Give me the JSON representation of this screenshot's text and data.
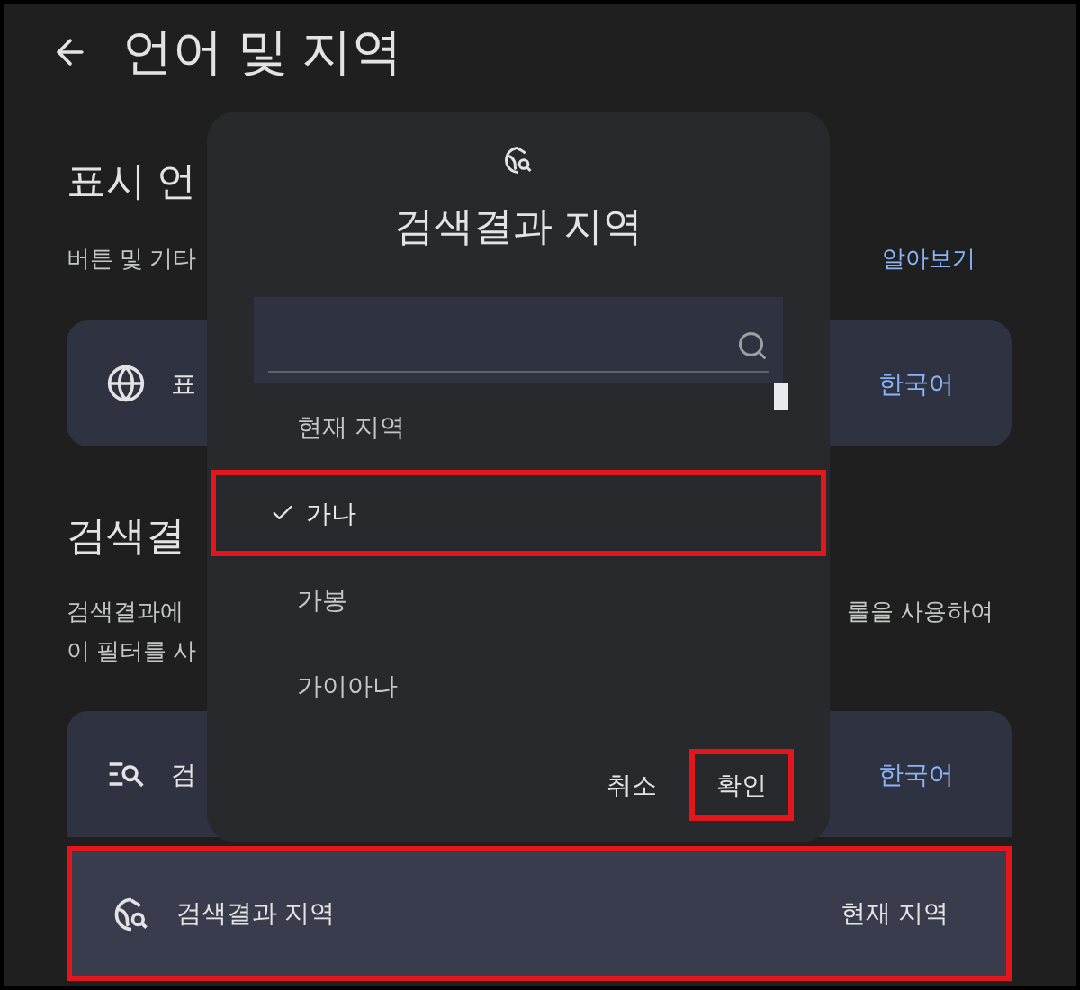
{
  "header": {
    "title": "언어 및 지역"
  },
  "display_section": {
    "heading": "표시 언",
    "description": "버튼 및 기타",
    "learn_more_link": "알아보기",
    "row": {
      "kind": "language",
      "label": "표",
      "value": "한국어",
      "highlighted": false
    }
  },
  "search_section": {
    "heading": "검색결",
    "description_lines": [
      {
        "left": "검색결과에",
        "right": "롤을 사용하여"
      },
      {
        "left": "이 필터를 사"
      }
    ],
    "rows": [
      {
        "kind": "language",
        "label": "검",
        "value": "한국어",
        "highlighted": false
      },
      {
        "kind": "region",
        "label": "검색결과 지역",
        "value": "현재 지역",
        "highlighted": true
      }
    ]
  },
  "dialog": {
    "title": "검색결과 지역",
    "options": [
      {
        "label": "현재 지역",
        "selected": false,
        "highlighted": false
      },
      {
        "label": "가나",
        "selected": true,
        "highlighted": true
      },
      {
        "label": "가봉",
        "selected": false,
        "highlighted": false
      },
      {
        "label": "가이아나",
        "selected": false,
        "highlighted": false
      }
    ],
    "buttons": [
      {
        "label": "취소",
        "highlighted": false
      },
      {
        "label": "확인",
        "highlighted": true
      }
    ]
  }
}
